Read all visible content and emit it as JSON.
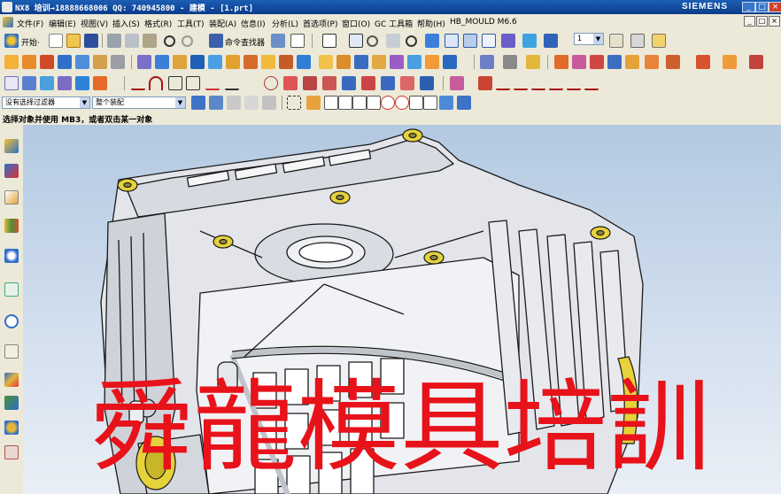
{
  "window": {
    "title": "NX8 培训→18888668006 QQ: 740945800 - 建模 - [1.prt]",
    "brand": "SIEMENS",
    "controls": [
      "_",
      "□",
      "×"
    ]
  },
  "menubar": {
    "items": [
      "文件(F)",
      "编辑(E)",
      "视图(V)",
      "插入(S)",
      "格式(R)",
      "工具(T)",
      "装配(A)",
      "信息(I)",
      "分析(L)",
      "首选项(P)",
      "窗口(O)",
      "GC 工具箱",
      "帮助(H)",
      "HB_MOULD M6.6"
    ],
    "mdi_controls": [
      "_",
      "□",
      "×"
    ]
  },
  "toolbar_standard": {
    "start_label": "开始·",
    "command_finder_label": "命令查找器",
    "layer_value": "1"
  },
  "filterbar": {
    "type_filter": "没有选择过滤器",
    "scope": "整个装配"
  },
  "status": {
    "prompt": "选择对象并使用 MB3，或者双击某一对象"
  },
  "watermark": {
    "text": "舜龍模具培訓",
    "color": "#e8121a"
  },
  "model": {
    "boss_color": "#e6d23a",
    "body_color": "#e3e5ea",
    "edge_color": "#1a1a1a"
  },
  "icons": {
    "resource_bar": [
      "assembly-navigator-icon",
      "constraint-navigator-icon",
      "part-navigator-icon",
      "reuse-library-icon",
      "hd3d-tools-icon",
      "web-browser-icon",
      "history-icon",
      "process-studio-icon",
      "roles-icon",
      "system-scenes-icon",
      "machine-tool-icon",
      "palette-icon"
    ]
  }
}
